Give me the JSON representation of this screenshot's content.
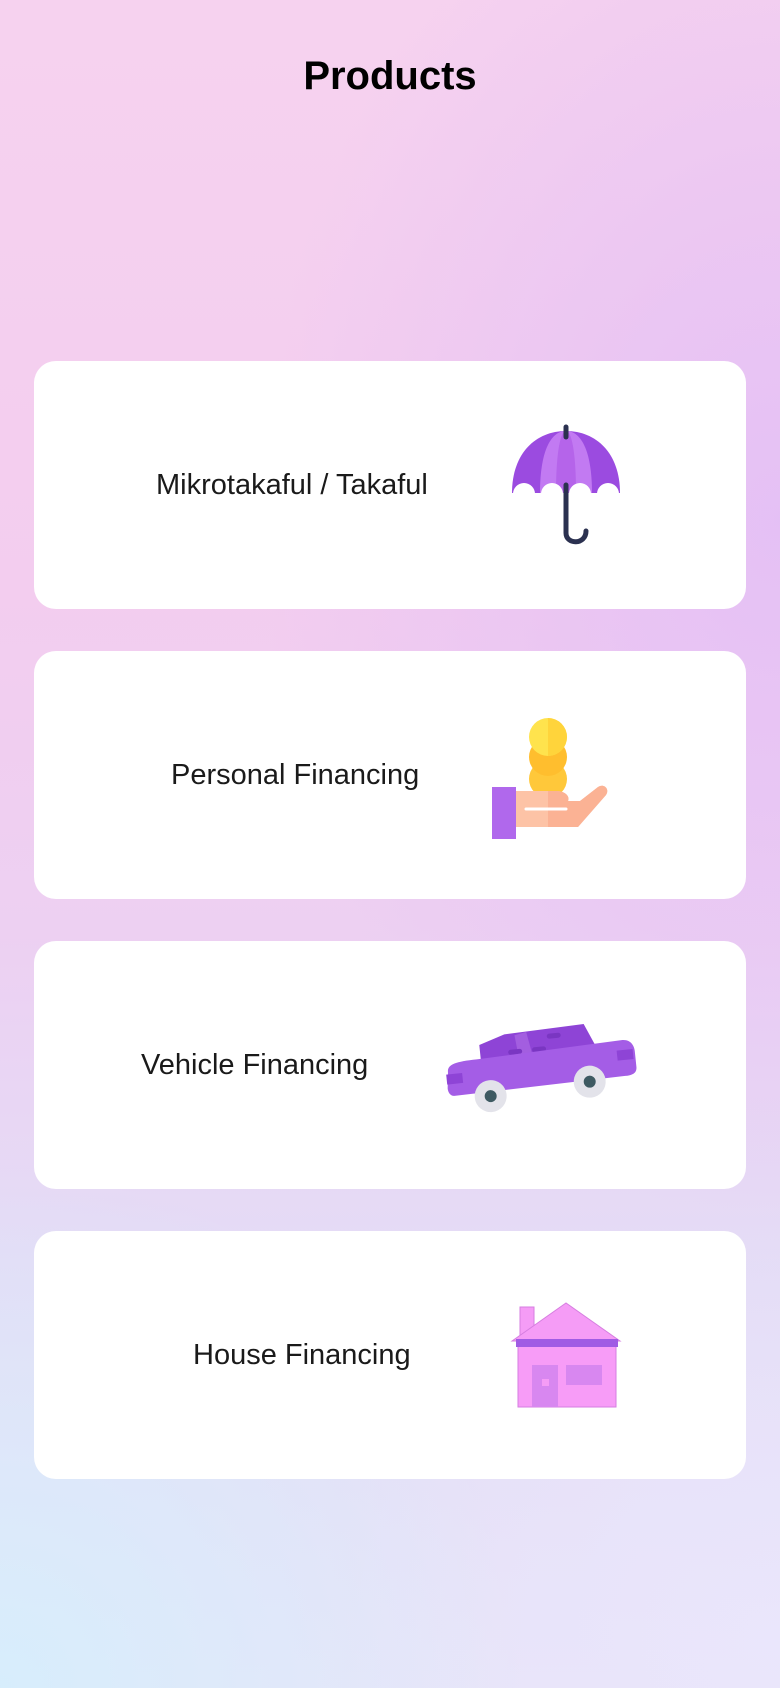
{
  "page": {
    "title": "Products"
  },
  "products": [
    {
      "label": "Mikrotakaful / Takaful",
      "icon": "umbrella-icon"
    },
    {
      "label": "Personal Financing",
      "icon": "coins-hand-icon"
    },
    {
      "label": "Vehicle Financing",
      "icon": "car-icon"
    },
    {
      "label": "House Financing",
      "icon": "house-icon"
    }
  ],
  "colors": {
    "card_background": "#ffffff",
    "title_text": "#000000",
    "label_text": "#1a1a1a",
    "icon_purple": "#a855e8",
    "icon_pink": "#f59cf6",
    "coin_yellow": "#ffd43b",
    "hand_skin": "#fdc3a6"
  }
}
